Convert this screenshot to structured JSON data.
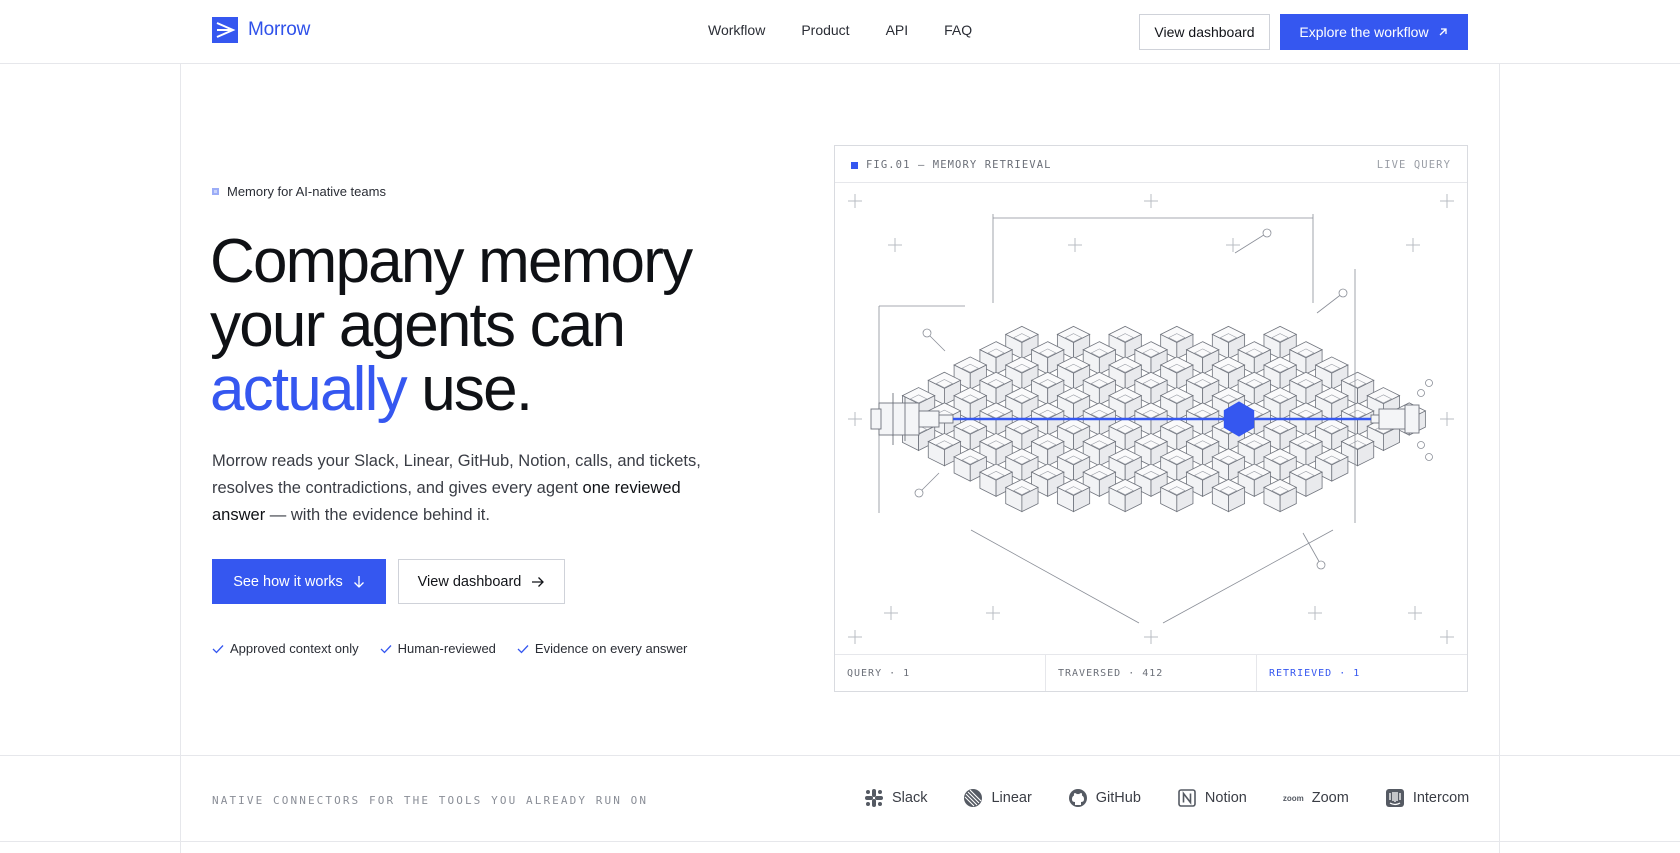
{
  "brand": {
    "name": "Morrow",
    "accent": "#3557f0"
  },
  "nav": [
    "Workflow",
    "Product",
    "API",
    "FAQ"
  ],
  "header_actions": {
    "dashboard": "View dashboard",
    "explore": "Explore the workflow"
  },
  "hero": {
    "eyebrow": "Memory for AI-native teams",
    "headline_line1": "Company memory",
    "headline_line2": "your agents can",
    "headline_accent": "actually",
    "headline_end": " use.",
    "lede_start": "Morrow reads your Slack, Linear, GitHub, Notion, calls, and tickets, resolves the contradictions, and gives every agent ",
    "lede_strong": "one reviewed answer",
    "lede_end": " — with the evidence behind it.",
    "cta_primary": "See how it works",
    "cta_secondary": "View dashboard",
    "checks": [
      "Approved context only",
      "Human-reviewed",
      "Evidence on every answer"
    ]
  },
  "figure": {
    "title": "FIG.01 — MEMORY RETRIEVAL",
    "status": "LIVE QUERY",
    "stats": [
      "QUERY · 1",
      "TRAVERSED · 412",
      "RETRIEVED · 1"
    ]
  },
  "connectors": {
    "label": "NATIVE CONNECTORS FOR THE TOOLS YOU ALREADY RUN ON",
    "items": [
      {
        "name": "Slack",
        "icon": "slack-icon"
      },
      {
        "name": "Linear",
        "icon": "linear-icon"
      },
      {
        "name": "GitHub",
        "icon": "github-icon"
      },
      {
        "name": "Notion",
        "icon": "notion-icon"
      },
      {
        "name": "Zoom",
        "icon": "zoom-icon",
        "icon_text": "zoom"
      },
      {
        "name": "Intercom",
        "icon": "intercom-icon"
      }
    ]
  }
}
